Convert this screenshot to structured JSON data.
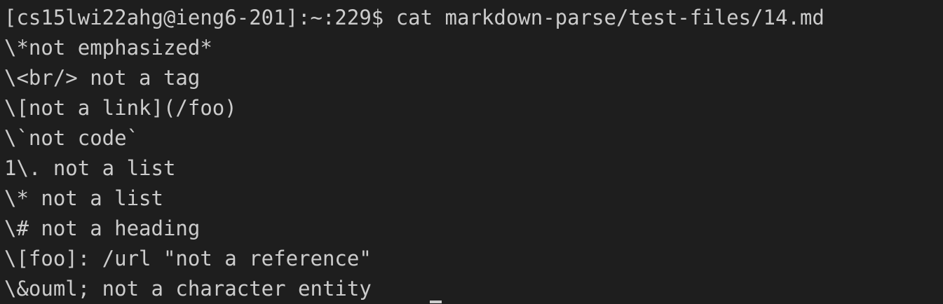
{
  "terminal": {
    "prompt": "[cs15lwi22ahg@ieng6-201]:~:229$",
    "command": " cat markdown-parse/test-files/14.md",
    "output": [
      "\\*not emphasized*",
      "\\<br/> not a tag",
      "\\[not a link](/foo)",
      "\\`not code`",
      "1\\. not a list",
      "\\* not a list",
      "\\# not a heading",
      "\\[foo]: /url \"not a reference\"",
      "\\&ouml; not a character entity"
    ]
  },
  "colors": {
    "background": "#1e1e1e",
    "foreground": "#cccccc"
  }
}
